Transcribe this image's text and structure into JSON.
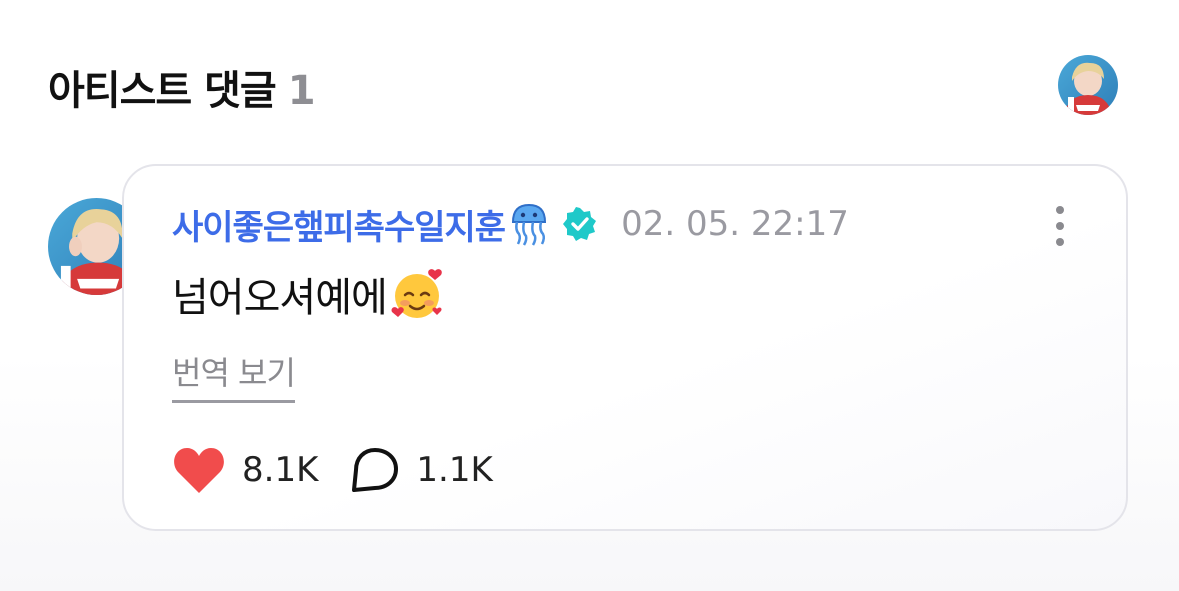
{
  "section": {
    "title": "아티스트 댓글",
    "count": "1"
  },
  "comment": {
    "author": "사이좋은햎피촉수일지훈",
    "author_emoji": "jellyfish-icon",
    "verified_icon": "verified-badge-icon",
    "timestamp": "02. 05. 22:17",
    "text": "넘어오셔예에",
    "text_emoji": "smiling-face-with-hearts-icon",
    "translate_label": "번역 보기",
    "likes": "8.1K",
    "replies": "1.1K",
    "more_icon": "more-vertical-icon"
  },
  "colors": {
    "author": "#3d6ce8",
    "verified": "#1fc9c9",
    "heart": "#f14c4c",
    "muted": "#9a9aa1",
    "border": "#e4e4ea"
  }
}
